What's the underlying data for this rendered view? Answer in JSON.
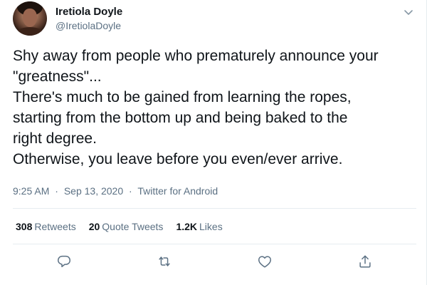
{
  "author": {
    "name": "Iretiola Doyle",
    "handle": "@IretiolaDoyle"
  },
  "tweet": {
    "lines": [
      "Shy away from people who prematurely announce your",
      "\"greatness\"...",
      "There's much to be gained from learning the ropes,",
      "starting from the bottom up and being baked to the",
      "right degree.",
      "Otherwise, you leave before you even/ever arrive."
    ]
  },
  "meta": {
    "time": "9:25 AM",
    "separator": "·",
    "date": "Sep 13, 2020",
    "source": "Twitter for Android"
  },
  "stats": {
    "retweets_count": "308",
    "retweets_label": "Retweets",
    "quotes_count": "20",
    "quotes_label": "Quote Tweets",
    "likes_count": "1.2K",
    "likes_label": "Likes"
  },
  "icons": {
    "more": "chevron-down-icon",
    "reply": "reply-icon",
    "retweet": "retweet-icon",
    "like": "heart-icon",
    "share": "share-icon"
  },
  "colors": {
    "text": "#0f1419",
    "secondary": "#5b7083",
    "divider": "#e6ecf0"
  }
}
